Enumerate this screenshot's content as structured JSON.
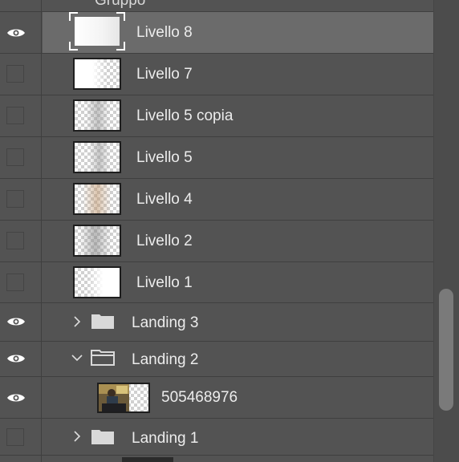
{
  "top_partial_label": "Gruppo",
  "layers": [
    {
      "name": "Livello 8",
      "visible": true,
      "selected": true
    },
    {
      "name": "Livello 7",
      "visible": false
    },
    {
      "name": "Livello 5 copia",
      "visible": false
    },
    {
      "name": "Livello 5",
      "visible": false
    },
    {
      "name": "Livello 4",
      "visible": false
    },
    {
      "name": "Livello 2",
      "visible": false
    },
    {
      "name": "Livello 1",
      "visible": false
    }
  ],
  "groups": [
    {
      "name": "Landing 3",
      "visible": true,
      "expanded": false
    },
    {
      "name": "Landing 2",
      "visible": true,
      "expanded": true,
      "children": [
        {
          "name": "505468976",
          "visible": true
        }
      ]
    },
    {
      "name": "Landing 1",
      "visible": false,
      "expanded": false
    }
  ],
  "icons": {
    "visibility": "eye-icon",
    "hidden": "empty-visibility-box",
    "collapsed": "chevron-right-icon",
    "expanded": "chevron-down-icon",
    "folder": "folder-icon",
    "open_folder": "open-folder-icon"
  },
  "colors": {
    "panel_bg": "#535353",
    "selected_row": "#6b6b6b",
    "divider": "#3f3f3f",
    "text": "#ececec"
  }
}
